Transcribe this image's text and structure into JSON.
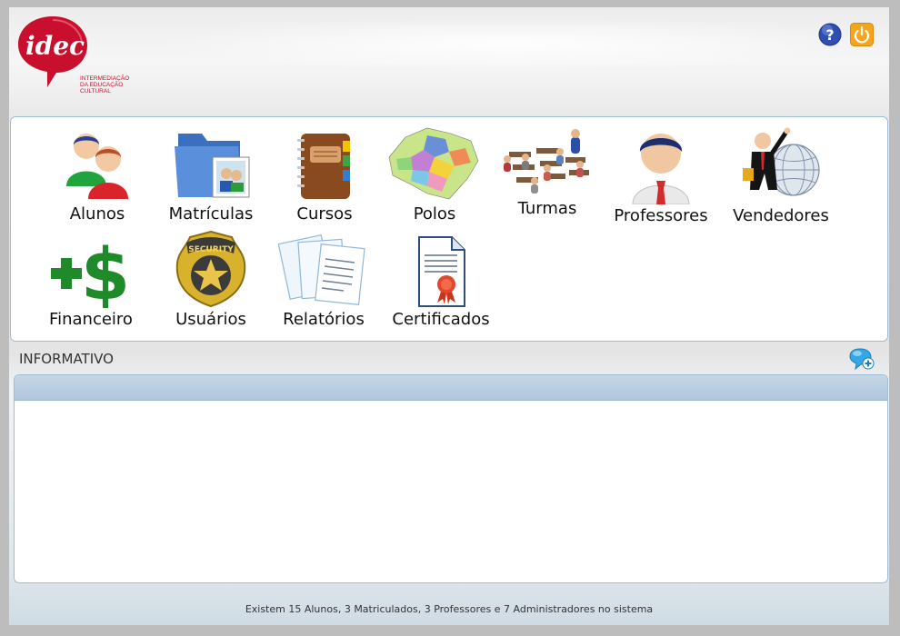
{
  "brand": {
    "logo_text": "idec",
    "subtitle_lines": [
      "INTERMEDIAÇÃO",
      "DA EDUCAÇÃO",
      "CULTURAL"
    ],
    "color": "#c8102e"
  },
  "header": {
    "help_icon": "help-icon",
    "power_icon": "power-icon"
  },
  "menu": {
    "items": [
      {
        "label": "Alunos",
        "icon": "students-icon"
      },
      {
        "label": "Matrículas",
        "icon": "enrollment-folder-icon"
      },
      {
        "label": "Cursos",
        "icon": "notebook-icon"
      },
      {
        "label": "Polos",
        "icon": "map-icon"
      },
      {
        "label": "Turmas",
        "icon": "classroom-icon"
      },
      {
        "label": "Professores",
        "icon": "teacher-icon"
      },
      {
        "label": "Vendedores",
        "icon": "salesman-globe-icon"
      },
      {
        "label": "Financeiro",
        "icon": "plus-dollar-icon"
      },
      {
        "label": "Usuários",
        "icon": "security-badge-icon"
      },
      {
        "label": "Relatórios",
        "icon": "reports-icon"
      },
      {
        "label": "Certificados",
        "icon": "certificate-icon"
      }
    ]
  },
  "informativo": {
    "title": "INFORMATIVO",
    "add_icon": "add-comment-icon"
  },
  "footer": {
    "status": "Existem 15 Alunos, 3 Matriculados, 3 Professores e 7 Administradores no sistema"
  },
  "colors": {
    "accent_blue": "#9fbcd6",
    "brand_red": "#c8102e",
    "money_green": "#1f8a2a",
    "power_orange": "#f5a51c"
  }
}
